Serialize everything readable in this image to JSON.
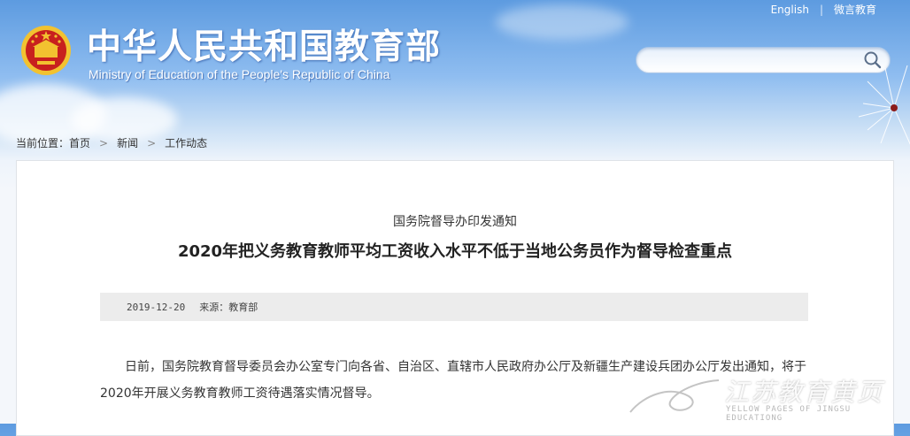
{
  "topbar": {
    "english_label": "English",
    "separator": "|",
    "weibo_label": "微言教育"
  },
  "header": {
    "title_cn": "中华人民共和国教育部",
    "title_en": "Ministry of Education of the People's Republic of China",
    "search": {
      "placeholder": "",
      "icon": "search-icon"
    }
  },
  "breadcrumb": {
    "prefix": "当前位置：",
    "items": [
      "首页",
      "新闻",
      "工作动态"
    ],
    "separator": ">"
  },
  "article": {
    "subtitle": "国务院督导办印发通知",
    "title": "2020年把义务教育教师平均工资收入水平不低于当地公务员作为督导检查重点",
    "date": "2019-12-20",
    "source": "来源：教育部",
    "paragraph": "日前，国务院教育督导委员会办公室专门向各省、自治区、直辖市人民政府办公厅及新疆生产建设兵团办公厅发出通知，将于2020年开展义务教育教师工资待遇落实情况督导。"
  },
  "watermark": {
    "cn": "江苏教育黄页",
    "en": "YELLOW PAGES OF JINGSU EDUCATIONG"
  },
  "colors": {
    "sky_top": "#5d9be0",
    "emblem_red": "#c8201e",
    "emblem_gold": "#f2c230",
    "meta_bg": "#ececec"
  }
}
